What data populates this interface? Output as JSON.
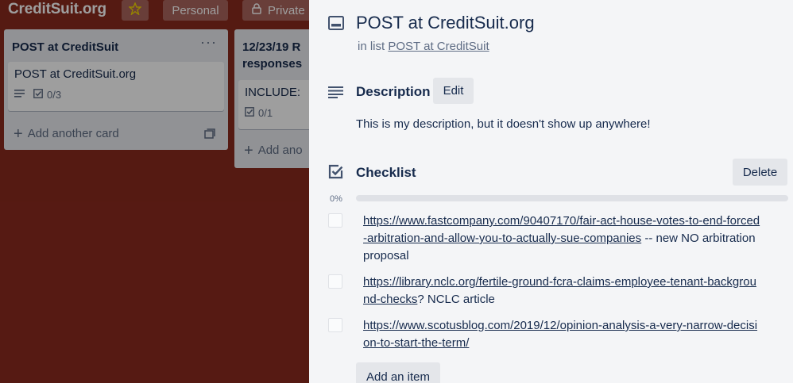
{
  "board": {
    "title": "CreditSuit.org",
    "star_icon": "star-icon",
    "personal_label": "Personal",
    "private_label": "Private",
    "lock_icon": "lock-icon"
  },
  "lists": [
    {
      "title": "POST at CreditSuit",
      "menu": "···",
      "cards": [
        {
          "title": "POST at CreditSuit.org",
          "checklist_badge": "0/3"
        }
      ],
      "add_card_label": "Add another card"
    },
    {
      "title_line1": "12/23/19 R",
      "title_line2": "responses",
      "cards": [
        {
          "title": "INCLUDE:",
          "checklist_badge": "0/1"
        }
      ],
      "add_card_label": "Add ano"
    }
  ],
  "card_detail": {
    "title": "POST at CreditSuit.org",
    "in_list_prefix": "in list",
    "in_list_name": "POST at CreditSuit",
    "description": {
      "heading": "Description",
      "edit_label": "Edit",
      "text": "This is my description, but it doesn't show up anywhere!"
    },
    "checklist": {
      "heading": "Checklist",
      "delete_label": "Delete",
      "progress_label": "0%",
      "progress": 0,
      "items": [
        {
          "link": "https://www.fastcompany.com/90407170/fair-act-house-votes-to-end-forced-arbitration-and-allow-you-to-actually-sue-companies",
          "suffix": " -- new NO arbitration proposal",
          "checked": false
        },
        {
          "link": "https://library.nclc.org/fertile-ground-fcra-claims-employee-tenant-background-checks",
          "suffix": "? NCLC article",
          "checked": false
        },
        {
          "link": "https://www.scotusblog.com/2019/12/opinion-analysis-a-very-narrow-decision-to-start-the-term/",
          "suffix": "",
          "checked": false
        }
      ],
      "add_item_label": "Add an item"
    }
  },
  "colors": {
    "board_bg": "#8a2a1e",
    "panel_bg": "#f4f5f7",
    "progress": "#5ba4cf"
  }
}
